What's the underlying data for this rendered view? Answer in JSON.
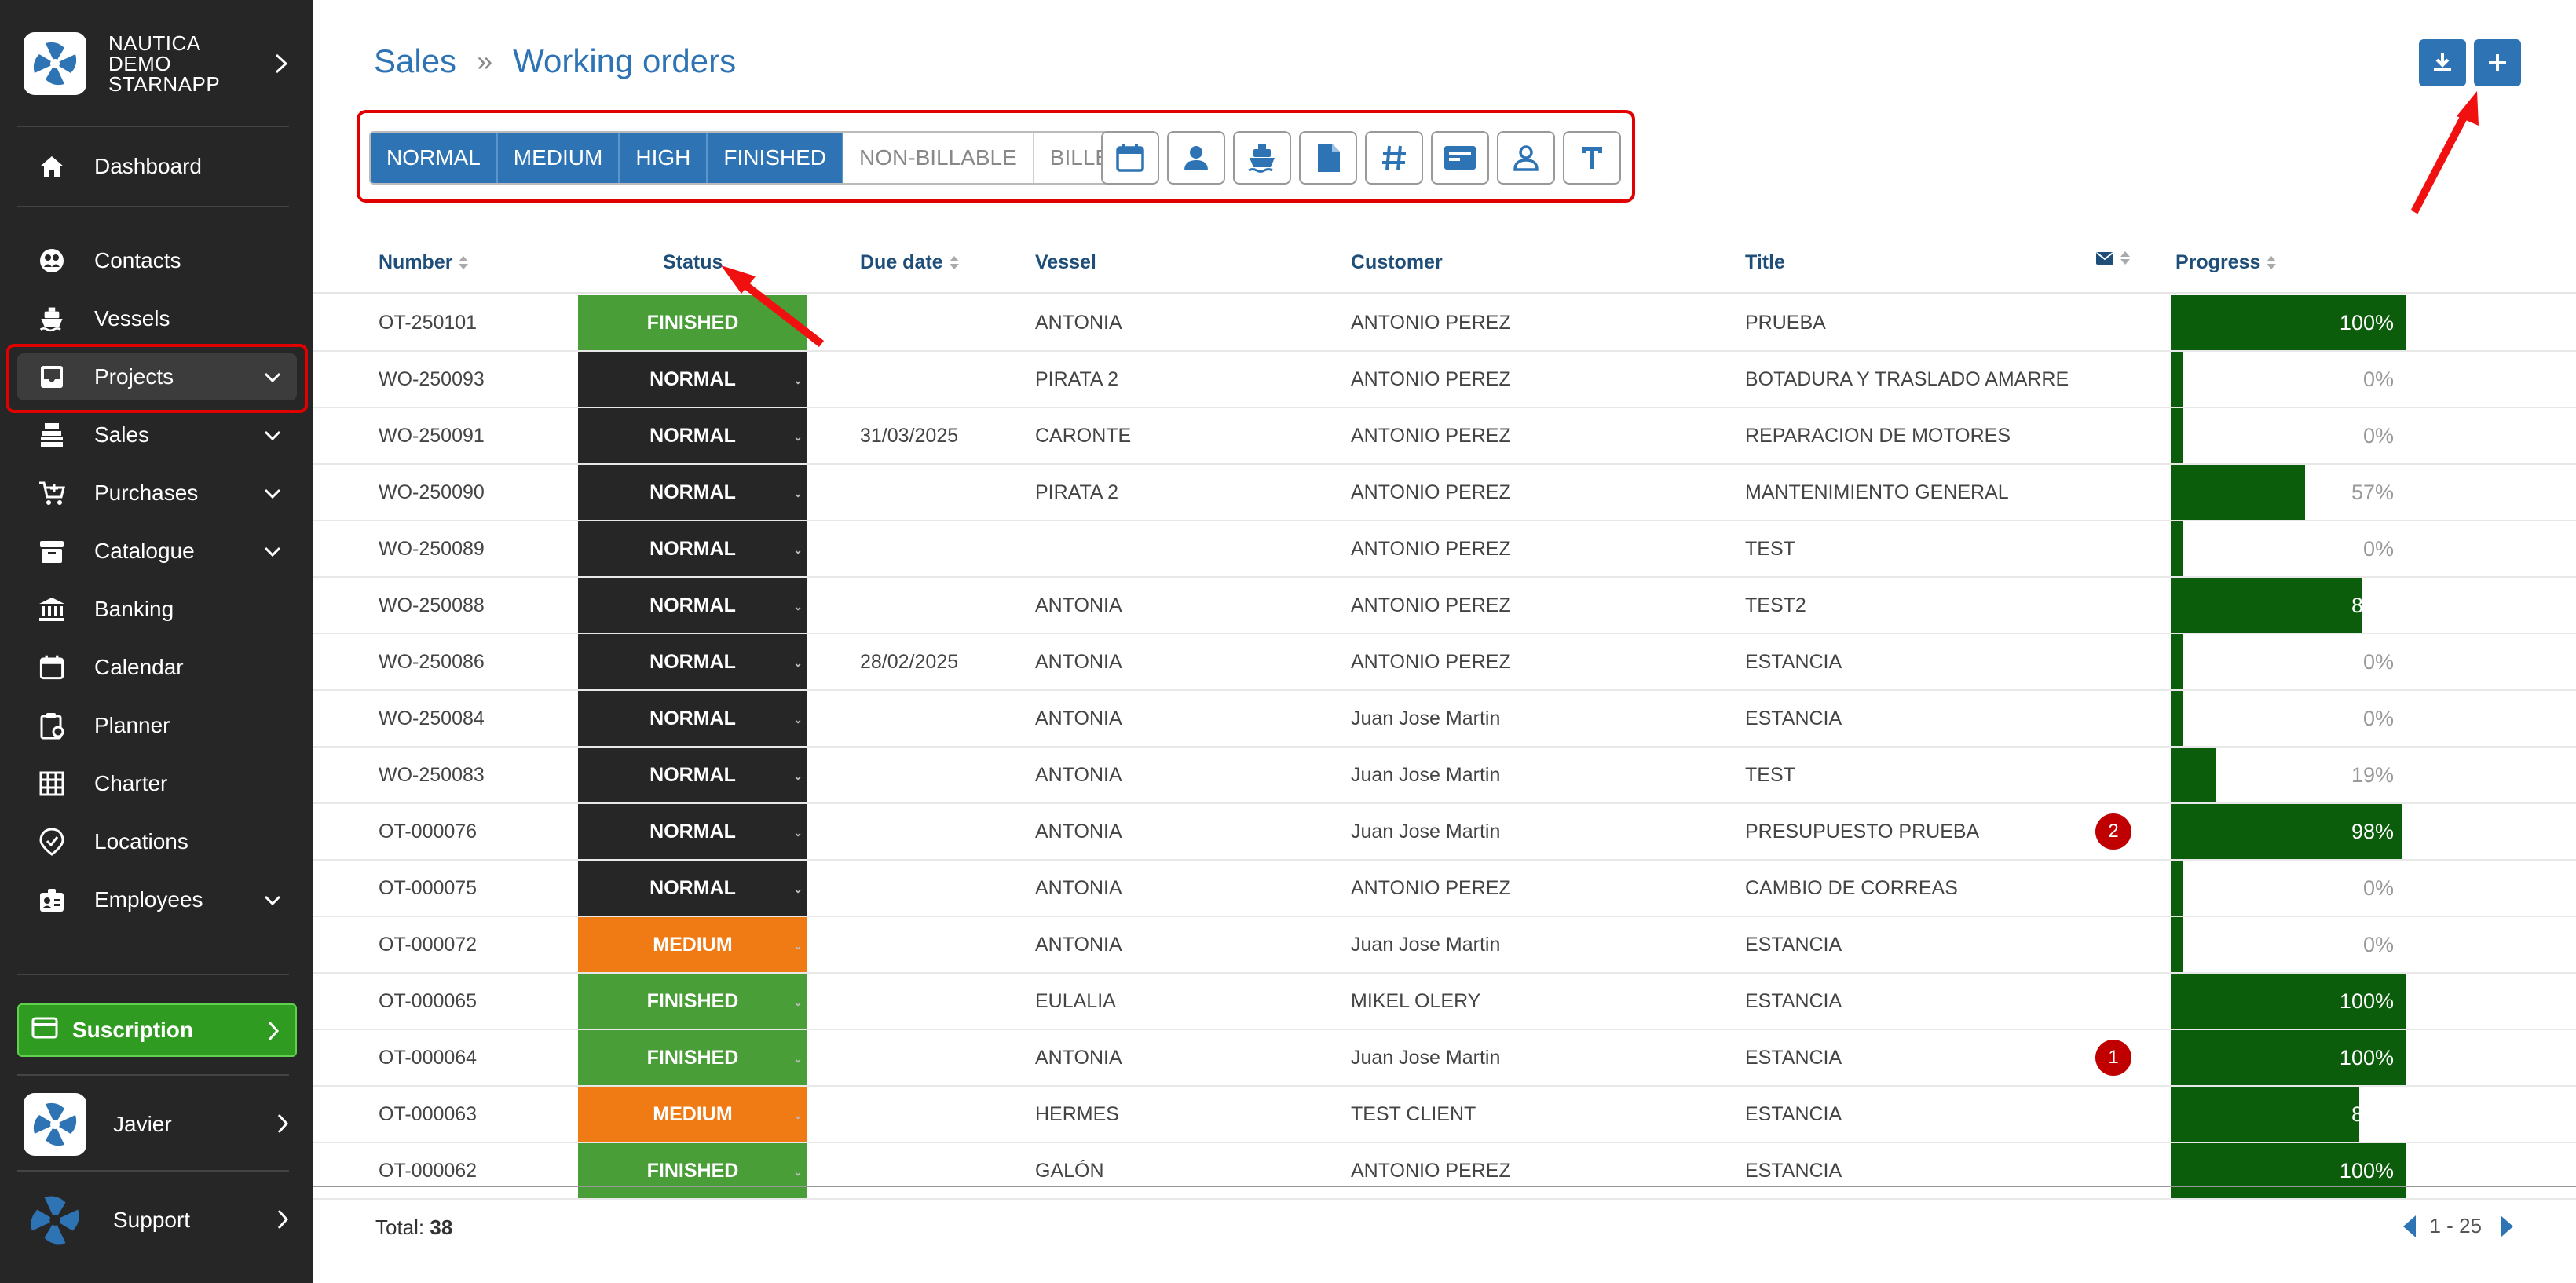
{
  "sidebar": {
    "company": "NAUTICA DEMO STARNAPP",
    "items": [
      {
        "label": "Dashboard",
        "icon": "home-icon",
        "has_chevron": false
      },
      {
        "label": "Contacts",
        "icon": "contacts-icon",
        "has_chevron": false
      },
      {
        "label": "Vessels",
        "icon": "ship-icon",
        "has_chevron": false
      },
      {
        "label": "Projects",
        "icon": "inbox-icon",
        "has_chevron": true
      },
      {
        "label": "Sales",
        "icon": "register-icon",
        "has_chevron": true
      },
      {
        "label": "Purchases",
        "icon": "cart-icon",
        "has_chevron": true
      },
      {
        "label": "Catalogue",
        "icon": "archive-icon",
        "has_chevron": true
      },
      {
        "label": "Banking",
        "icon": "bank-icon",
        "has_chevron": false
      },
      {
        "label": "Calendar",
        "icon": "calendar-icon",
        "has_chevron": false
      },
      {
        "label": "Planner",
        "icon": "clipboard-icon",
        "has_chevron": false
      },
      {
        "label": "Charter",
        "icon": "grid-icon",
        "has_chevron": false
      },
      {
        "label": "Locations",
        "icon": "location-icon",
        "has_chevron": false
      },
      {
        "label": "Employees",
        "icon": "badge-icon",
        "has_chevron": true
      }
    ],
    "subscription": "Suscription",
    "user": "Javier",
    "support": "Support"
  },
  "header": {
    "breadcrumb_root": "Sales",
    "breadcrumb_current": "Working orders"
  },
  "filters": {
    "segments": [
      {
        "label": "NORMAL",
        "active": true
      },
      {
        "label": "MEDIUM",
        "active": true
      },
      {
        "label": "HIGH",
        "active": true
      },
      {
        "label": "FINISHED",
        "active": true
      },
      {
        "label": "NON-BILLABLE",
        "active": false
      },
      {
        "label": "BILLED",
        "active": false
      }
    ],
    "icon_buttons": [
      "calendar-icon",
      "person-icon",
      "ship-icon",
      "document-icon",
      "hash-icon",
      "card-icon",
      "user-outline-icon",
      "text-icon"
    ]
  },
  "table": {
    "columns": {
      "number": "Number",
      "status": "Status",
      "due_date": "Due date",
      "vessel": "Vessel",
      "customer": "Customer",
      "title": "Title",
      "progress": "Progress"
    },
    "rows": [
      {
        "number": "OT-250101",
        "status": "FINISHED",
        "due": "",
        "vessel": "ANTONIA",
        "customer": "ANTONIO PEREZ",
        "title": "PRUEBA",
        "badge": "",
        "progress": 100
      },
      {
        "number": "WO-250093",
        "status": "NORMAL",
        "due": "",
        "vessel": "PIRATA 2",
        "customer": "ANTONIO PEREZ",
        "title": "BOTADURA Y TRASLADO AMARRE",
        "badge": "",
        "progress": 0
      },
      {
        "number": "WO-250091",
        "status": "NORMAL",
        "due": "31/03/2025",
        "vessel": "CARONTE",
        "customer": "ANTONIO PEREZ",
        "title": "REPARACION DE MOTORES",
        "badge": "",
        "progress": 0
      },
      {
        "number": "WO-250090",
        "status": "NORMAL",
        "due": "",
        "vessel": "PIRATA 2",
        "customer": "ANTONIO PEREZ",
        "title": "MANTENIMIENTO GENERAL",
        "badge": "",
        "progress": 57
      },
      {
        "number": "WO-250089",
        "status": "NORMAL",
        "due": "",
        "vessel": "",
        "customer": "ANTONIO PEREZ",
        "title": "TEST",
        "badge": "",
        "progress": 0
      },
      {
        "number": "WO-250088",
        "status": "NORMAL",
        "due": "",
        "vessel": "ANTONIA",
        "customer": "ANTONIO PEREZ",
        "title": "TEST2",
        "badge": "",
        "progress": 81
      },
      {
        "number": "WO-250086",
        "status": "NORMAL",
        "due": "28/02/2025",
        "vessel": "ANTONIA",
        "customer": "ANTONIO PEREZ",
        "title": "ESTANCIA",
        "badge": "",
        "progress": 0
      },
      {
        "number": "WO-250084",
        "status": "NORMAL",
        "due": "",
        "vessel": "ANTONIA",
        "customer": "Juan Jose Martin",
        "title": "ESTANCIA",
        "badge": "",
        "progress": 0
      },
      {
        "number": "WO-250083",
        "status": "NORMAL",
        "due": "",
        "vessel": "ANTONIA",
        "customer": "Juan Jose Martin",
        "title": "TEST",
        "badge": "",
        "progress": 19
      },
      {
        "number": "OT-000076",
        "status": "NORMAL",
        "due": "",
        "vessel": "ANTONIA",
        "customer": "Juan Jose Martin",
        "title": "PRESUPUESTO PRUEBA",
        "badge": "2",
        "progress": 98
      },
      {
        "number": "OT-000075",
        "status": "NORMAL",
        "due": "",
        "vessel": "ANTONIA",
        "customer": "ANTONIO PEREZ",
        "title": "CAMBIO DE CORREAS",
        "badge": "",
        "progress": 0
      },
      {
        "number": "OT-000072",
        "status": "MEDIUM",
        "due": "",
        "vessel": "ANTONIA",
        "customer": "Juan Jose Martin",
        "title": "ESTANCIA",
        "badge": "",
        "progress": 0
      },
      {
        "number": "OT-000065",
        "status": "FINISHED",
        "due": "",
        "vessel": "EULALIA",
        "customer": "MIKEL OLERY",
        "title": "ESTANCIA",
        "badge": "",
        "progress": 100
      },
      {
        "number": "OT-000064",
        "status": "FINISHED",
        "due": "",
        "vessel": "ANTONIA",
        "customer": "Juan Jose Martin",
        "title": "ESTANCIA",
        "badge": "1",
        "progress": 100
      },
      {
        "number": "OT-000063",
        "status": "MEDIUM",
        "due": "",
        "vessel": "HERMES",
        "customer": "TEST CLIENT",
        "title": "ESTANCIA",
        "badge": "",
        "progress": 80
      },
      {
        "number": "OT-000062",
        "status": "FINISHED",
        "due": "",
        "vessel": "GALÓN",
        "customer": "ANTONIO PEREZ",
        "title": "ESTANCIA",
        "badge": "",
        "progress": 100
      }
    ]
  },
  "footer": {
    "total_label": "Total:",
    "total_value": "38",
    "pager": "1 - 25"
  },
  "colors": {
    "accent": "#2e74b5",
    "finished": "#4a9e37",
    "normal": "#262626",
    "medium": "#f07a14",
    "progress": "#0b5c0b",
    "badge": "#c00000",
    "highlight": "#e00000"
  }
}
